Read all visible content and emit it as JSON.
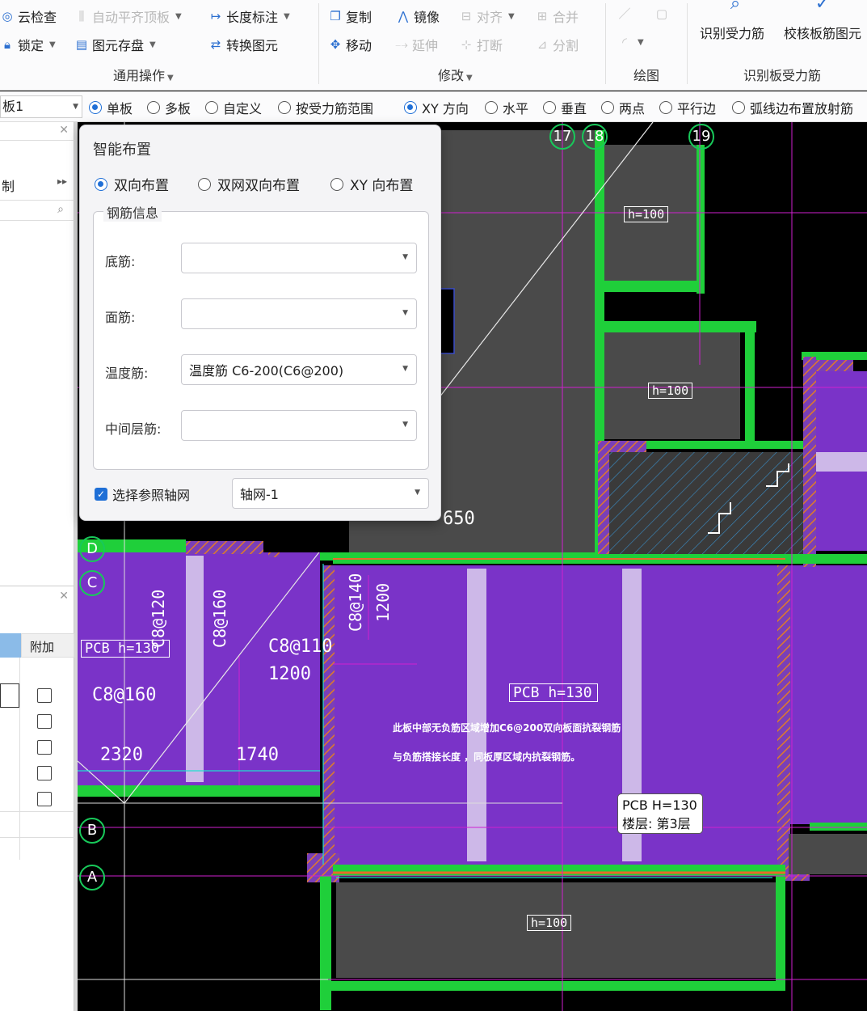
{
  "ribbon": {
    "groups": [
      "通用操作",
      "修改",
      "绘图",
      "识别板受力筋"
    ],
    "general": {
      "cloud_check": "云检查",
      "auto_align": "自动平齐顶板",
      "length_dim": "长度标注",
      "lock": "锁定",
      "element_save": "图元存盘",
      "convert": "转换图元"
    },
    "modify": {
      "copy": "复制",
      "mirror": "镜像",
      "align": "对齐",
      "merge": "合并",
      "move": "移动",
      "extend": "延伸",
      "break": "打断",
      "split": "分割"
    },
    "recognize": {
      "identify": "识别受力筋",
      "check": "校核板筋图元"
    }
  },
  "toolbar2": {
    "combo_value": "板1",
    "options": [
      "单板",
      "多板",
      "自定义",
      "按受力筋范围",
      "XY 方向",
      "水平",
      "垂直",
      "两点",
      "平行边",
      "弧线边布置放射筋"
    ]
  },
  "left_panel": {
    "fragment_label": "制",
    "col_header": "附加"
  },
  "dialog": {
    "title": "智能布置",
    "layout_options": [
      "双向布置",
      "双网双向布置",
      "XY 向布置"
    ],
    "legend": "钢筋信息",
    "fields": [
      {
        "label": "底筋:",
        "value": ""
      },
      {
        "label": "面筋:",
        "value": ""
      },
      {
        "label": "温度筋:",
        "value": "温度筋 C6-200(C6@200)"
      },
      {
        "label": "中间层筋:",
        "value": ""
      }
    ],
    "ref_axis_label": "选择参照轴网",
    "ref_axis_value": "轴网-1"
  },
  "canvas": {
    "axis_labels": [
      "17",
      "18",
      "19",
      "D",
      "C",
      "B",
      "A"
    ],
    "texts": {
      "h100_a": "h=100",
      "h100_b": "h=100",
      "h100_c": "h=100",
      "dim650": "650",
      "c8_120": "C8@120",
      "c8_160v": "C8@160",
      "c8_140": "C8@140",
      "v1200": "1200",
      "c8_110": "C8@110",
      "h1200": "1200",
      "pcb_left": "PCB h=130",
      "pcb_mid": "PCB h=130",
      "c8_160": "C8@160",
      "d2320": "2320",
      "d1740": "1740",
      "note1": "此板中部无负筋区域增加C6@200双向板面抗裂钢筋",
      "note2": "与负筋搭接长度 ，同板厚区域内抗裂钢筋。"
    }
  },
  "tooltip": {
    "line1": "PCB H=130",
    "line2": "楼层: 第3层"
  }
}
